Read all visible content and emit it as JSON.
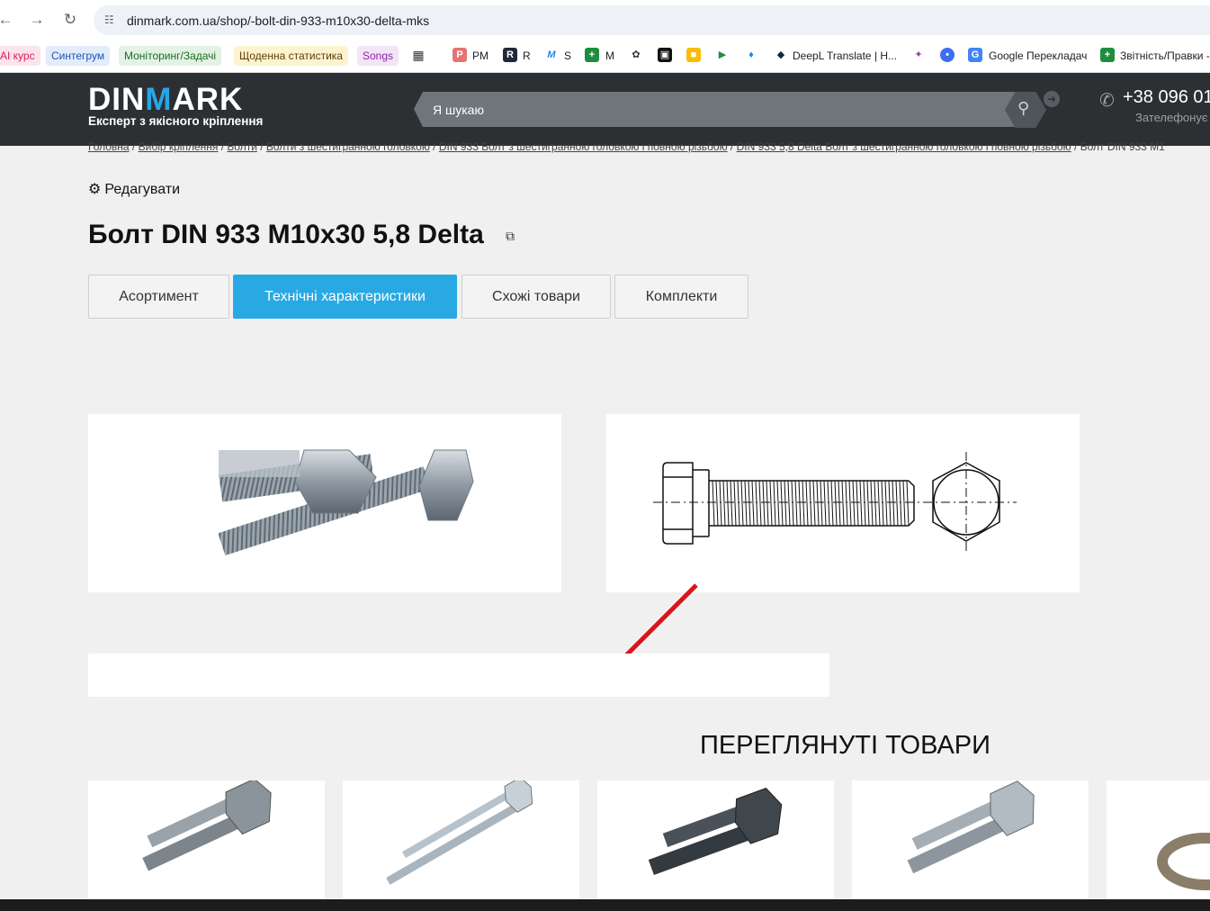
{
  "browser": {
    "url": "dinmark.com.ua/shop/-bolt-din-933-m10x30-delta-mks",
    "back_icon": "back-arrow-icon",
    "forward_icon": "forward-arrow-icon",
    "reload_icon": "reload-icon"
  },
  "bookmarks": [
    {
      "label": "AI курс",
      "color": "#d81b60",
      "bg": "#fce4ec"
    },
    {
      "label": "Синтегрум",
      "color": "#1a56b8",
      "bg": "#e3ecfb"
    },
    {
      "label": "Моніторинг/Задачі",
      "color": "#1b6e20",
      "bg": "#e3f2e4"
    },
    {
      "label": "Щоденна статистика",
      "color": "#5b4300",
      "bg": "#fdf3d0"
    },
    {
      "label": "Songs",
      "color": "#8e24aa",
      "bg": "#f3e5f5"
    },
    {
      "label": "PM"
    },
    {
      "label": "R"
    },
    {
      "label": "S"
    },
    {
      "label": "M"
    },
    {
      "label": "DeepL Translate | H..."
    },
    {
      "label": "Google Перекладач"
    },
    {
      "label": "Звітність/Правки -"
    }
  ],
  "header": {
    "logo_text_1": "DIN",
    "logo_text_m": "M",
    "logo_text_2": "ARK",
    "tagline": "Експерт з якісного кріплення",
    "search_placeholder": "Я шукаю",
    "phone": "+38 096 01",
    "call_label": "Зателефонує"
  },
  "breadcrumb": [
    "Головна",
    "Вибір кріплення",
    "Болти",
    "Болти з шестигранною головкою",
    "DIN 933 Болт з шестигранною головкою і повною різьбою",
    "DIN 933 5,8 Delta Болт з шестигранною головкою і повною різьбою",
    "Болт DIN 933 M1"
  ],
  "edit_label": "Редагувати",
  "product_title": "Болт DIN 933 M10x30 5,8 Delta",
  "tabs": [
    {
      "label": "Асортимент",
      "active": false
    },
    {
      "label": "Технічні характеристики",
      "active": true
    },
    {
      "label": "Схожі товари",
      "active": false
    },
    {
      "label": "Комплекти",
      "active": false
    }
  ],
  "viewed_title": "ПЕРЕГЛЯНУТІ ТОВАРИ",
  "colors": {
    "header_bg": "#2d3033",
    "accent": "#28a9e3",
    "annotation_arrow": "#d9141b"
  }
}
